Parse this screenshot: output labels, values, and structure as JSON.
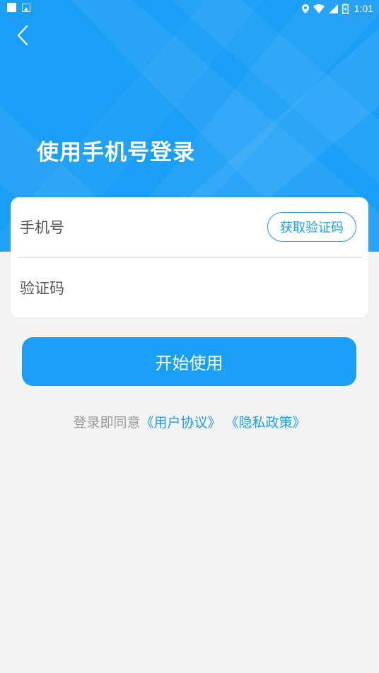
{
  "status_bar": {
    "time": "1:01",
    "icons": [
      "notification-square-icon",
      "notification-image-icon",
      "location-icon",
      "wifi-icon",
      "cell-signal-icon",
      "battery-icon"
    ]
  },
  "header": {
    "back_icon": "chevron-left-icon",
    "title": "使用手机号登录"
  },
  "form": {
    "phone_placeholder": "手机号",
    "phone_value": "",
    "get_code_label": "获取验证码",
    "code_placeholder": "验证码",
    "code_value": ""
  },
  "actions": {
    "start_label": "开始使用"
  },
  "agreement": {
    "prefix": "登录即同意",
    "user_agreement": "《用户协议》",
    "separator": " ",
    "privacy_policy": "《隐私政策》"
  },
  "colors": {
    "accent": "#1a9ff7",
    "background": "#f4f4f4",
    "card": "#ffffff",
    "muted_text": "#9a9a9a"
  }
}
